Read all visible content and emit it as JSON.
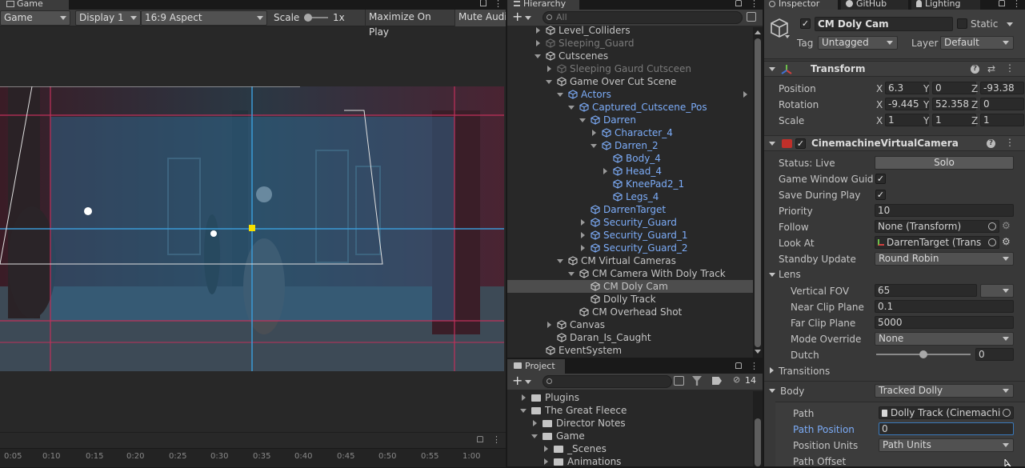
{
  "game": {
    "tab_label": "Game",
    "mode": "Game",
    "display": "Display 1",
    "aspect": "16:9 Aspect",
    "scale_label": "Scale",
    "scale_value": "1x",
    "maximize": "Maximize On Play",
    "mute": "Mute Audi",
    "timeline_ticks": [
      "0:05",
      "0:10",
      "0:15",
      "0:20",
      "0:25",
      "0:30",
      "0:35",
      "0:40",
      "0:45",
      "0:50",
      "0:55",
      "1:00"
    ]
  },
  "hierarchy": {
    "tab_label": "Hierarchy",
    "search_placeholder": "All",
    "items": [
      {
        "label": "Level_Colliders",
        "indent": 0,
        "fold": "c",
        "style": ""
      },
      {
        "label": "Sleeping_Guard",
        "indent": 0,
        "fold": "c",
        "style": "dim"
      },
      {
        "label": "Cutscenes",
        "indent": 0,
        "fold": "o",
        "style": ""
      },
      {
        "label": "Sleeping Gaurd Cutsceen",
        "indent": 1,
        "fold": "c",
        "style": "dim"
      },
      {
        "label": "Game Over Cut Scene",
        "indent": 1,
        "fold": "o",
        "style": ""
      },
      {
        "label": "Actors",
        "indent": 2,
        "fold": "o",
        "style": "blue"
      },
      {
        "label": "Captured_Cutscene_Pos",
        "indent": 3,
        "fold": "o",
        "style": "blue"
      },
      {
        "label": "Darren",
        "indent": 4,
        "fold": "o",
        "style": "blue"
      },
      {
        "label": "Character_4",
        "indent": 5,
        "fold": "c",
        "style": "blue"
      },
      {
        "label": "Darren_2",
        "indent": 5,
        "fold": "o",
        "style": "blue"
      },
      {
        "label": "Body_4",
        "indent": 6,
        "fold": "",
        "style": "blue"
      },
      {
        "label": "Head_4",
        "indent": 6,
        "fold": "c",
        "style": "blue"
      },
      {
        "label": "KneePad2_1",
        "indent": 6,
        "fold": "",
        "style": "blue"
      },
      {
        "label": "Legs_4",
        "indent": 6,
        "fold": "",
        "style": "blue"
      },
      {
        "label": "DarrenTarget",
        "indent": 4,
        "fold": "",
        "style": "blue"
      },
      {
        "label": "Security_Guard",
        "indent": 4,
        "fold": "c",
        "style": "blue"
      },
      {
        "label": "Security_Guard_1",
        "indent": 4,
        "fold": "c",
        "style": "blue"
      },
      {
        "label": "Security_Guard_2",
        "indent": 4,
        "fold": "c",
        "style": "blue"
      },
      {
        "label": "CM Virtual Cameras",
        "indent": 2,
        "fold": "o",
        "style": ""
      },
      {
        "label": "CM Camera With Doly Track",
        "indent": 3,
        "fold": "o",
        "style": ""
      },
      {
        "label": "CM Doly Cam",
        "indent": 4,
        "fold": "",
        "style": "",
        "selected": true
      },
      {
        "label": "Dolly Track",
        "indent": 4,
        "fold": "",
        "style": ""
      },
      {
        "label": "CM Overhead Shot",
        "indent": 3,
        "fold": "",
        "style": ""
      },
      {
        "label": "Canvas",
        "indent": 1,
        "fold": "c",
        "style": ""
      },
      {
        "label": "Daran_Is_Caught",
        "indent": 1,
        "fold": "",
        "style": ""
      },
      {
        "label": "EventSystem",
        "indent": 0,
        "fold": "",
        "style": ""
      }
    ]
  },
  "project": {
    "tab_label": "Project",
    "hidden_count": "14",
    "items": [
      {
        "label": "Plugins",
        "indent": 0,
        "fold": "c"
      },
      {
        "label": "The Great Fleece",
        "indent": 0,
        "fold": "o"
      },
      {
        "label": "Director Notes",
        "indent": 1,
        "fold": "c"
      },
      {
        "label": "Game",
        "indent": 1,
        "fold": "o"
      },
      {
        "label": "_Scenes",
        "indent": 2,
        "fold": "c"
      },
      {
        "label": "Animations",
        "indent": 2,
        "fold": "c"
      }
    ]
  },
  "inspector": {
    "tab_inspector": "Inspector",
    "tab_github": "GitHub",
    "tab_lighting": "Lighting",
    "object_name": "CM Doly Cam",
    "static_label": "Static",
    "tag_label": "Tag",
    "tag_value": "Untagged",
    "layer_label": "Layer",
    "layer_value": "Default",
    "transform": {
      "title": "Transform",
      "position_label": "Position",
      "rotation_label": "Rotation",
      "scale_label": "Scale",
      "position": {
        "x": "6.3",
        "y": "0",
        "z": "-93.38"
      },
      "rotation": {
        "x": "-9.445",
        "y": "52.358",
        "z": "0"
      },
      "scale": {
        "x": "1",
        "y": "1",
        "z": "1"
      }
    },
    "vcam": {
      "title": "CinemachineVirtualCamera",
      "status": "Status: Live",
      "solo": "Solo",
      "game_window_guides": "Game Window Guides",
      "save_during_play": "Save During Play",
      "priority_label": "Priority",
      "priority_value": "10",
      "follow_label": "Follow",
      "follow_value": "None (Transform)",
      "lookat_label": "Look At",
      "lookat_value": "DarrenTarget (Trans",
      "standby_label": "Standby Update",
      "standby_value": "Round Robin",
      "lens_label": "Lens",
      "fov_label": "Vertical FOV",
      "fov_value": "65",
      "near_label": "Near Clip Plane",
      "near_value": "0.1",
      "far_label": "Far Clip Plane",
      "far_value": "5000",
      "mode_override_label": "Mode Override",
      "mode_override_value": "None",
      "dutch_label": "Dutch",
      "dutch_value": "0",
      "dutch_fraction": 0.5,
      "transitions_label": "Transitions",
      "body_label": "Body",
      "body_value": "Tracked Dolly",
      "path_label": "Path",
      "path_value": "Dolly Track (Cinemachi",
      "path_position_label": "Path Position",
      "path_position_value": "0",
      "position_units_label": "Position Units",
      "position_units_value": "Path Units",
      "path_offset_label": "Path Offset"
    }
  }
}
